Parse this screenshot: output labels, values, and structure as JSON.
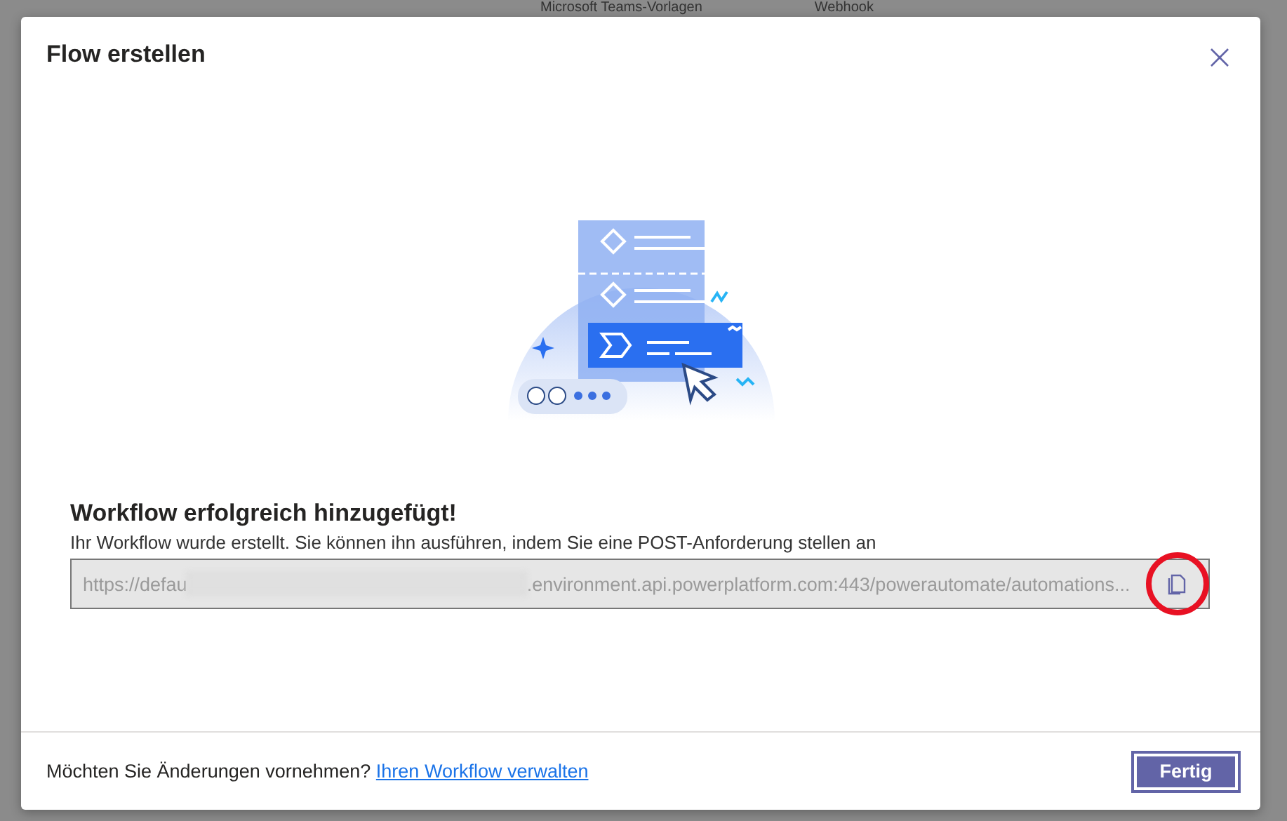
{
  "background": {
    "toolbar_items": [
      "Microsoft Teams-Vorlagen",
      "Webhook"
    ]
  },
  "dialog": {
    "title": "Flow erstellen",
    "success": {
      "heading": "Workflow erfolgreich hinzugefügt!",
      "description": "Ihr Workflow wurde erstellt. Sie können ihn ausführen, indem Sie eine POST-Anforderung stellen an",
      "url_field": {
        "value_start": "https://defau",
        "redacted": true,
        "value_end": ".environment.api.powerplatform.com:443/powerautomate/automations...",
        "disabled": true
      }
    },
    "annotation": {
      "kind": "circle",
      "color": "#e81123"
    },
    "footer": {
      "prompt": "Möchten Sie Änderungen vornehmen?",
      "link": "Ihren Workflow verwalten",
      "button": "Fertig"
    }
  }
}
